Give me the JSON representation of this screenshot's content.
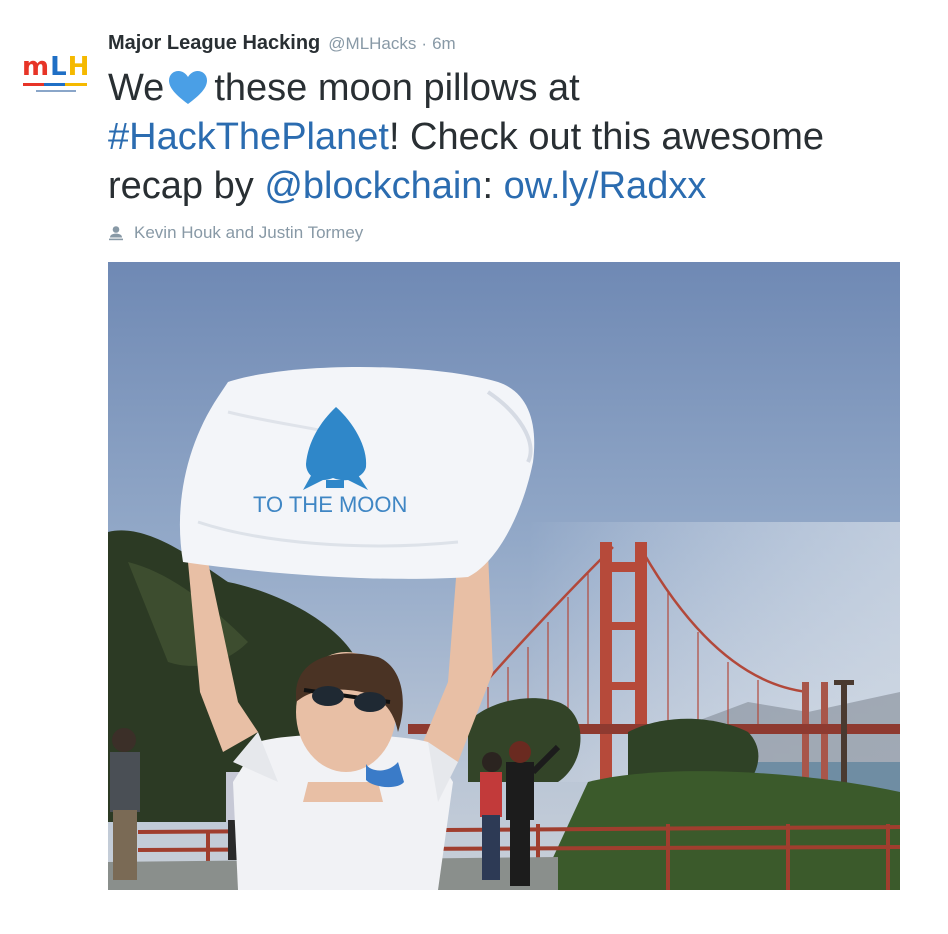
{
  "tweet": {
    "author_name": "Major League Hacking",
    "author_handle": "@MLHacks",
    "separator": "·",
    "timestamp": "6m",
    "avatar_letters": [
      "m",
      "L",
      "H"
    ],
    "text": {
      "part1": "We",
      "heart_icon": "heart-icon",
      "part2": "these moon pillows at",
      "hashtag": "#HackThePlanet",
      "part3": "! Check out this awesome recap by",
      "mention": "@blockchain",
      "colon": ":",
      "link": "ow.ly/Radxx"
    },
    "media_credit": {
      "icon": "person-icon",
      "text": "Kevin Houk and Justin Tormey"
    },
    "photo": {
      "pillow_text": "TO THE MOON"
    },
    "colors": {
      "link": "#2b6cb0",
      "heart": "#4a9fe6",
      "meta": "#8899a6",
      "text": "#292f33"
    }
  }
}
